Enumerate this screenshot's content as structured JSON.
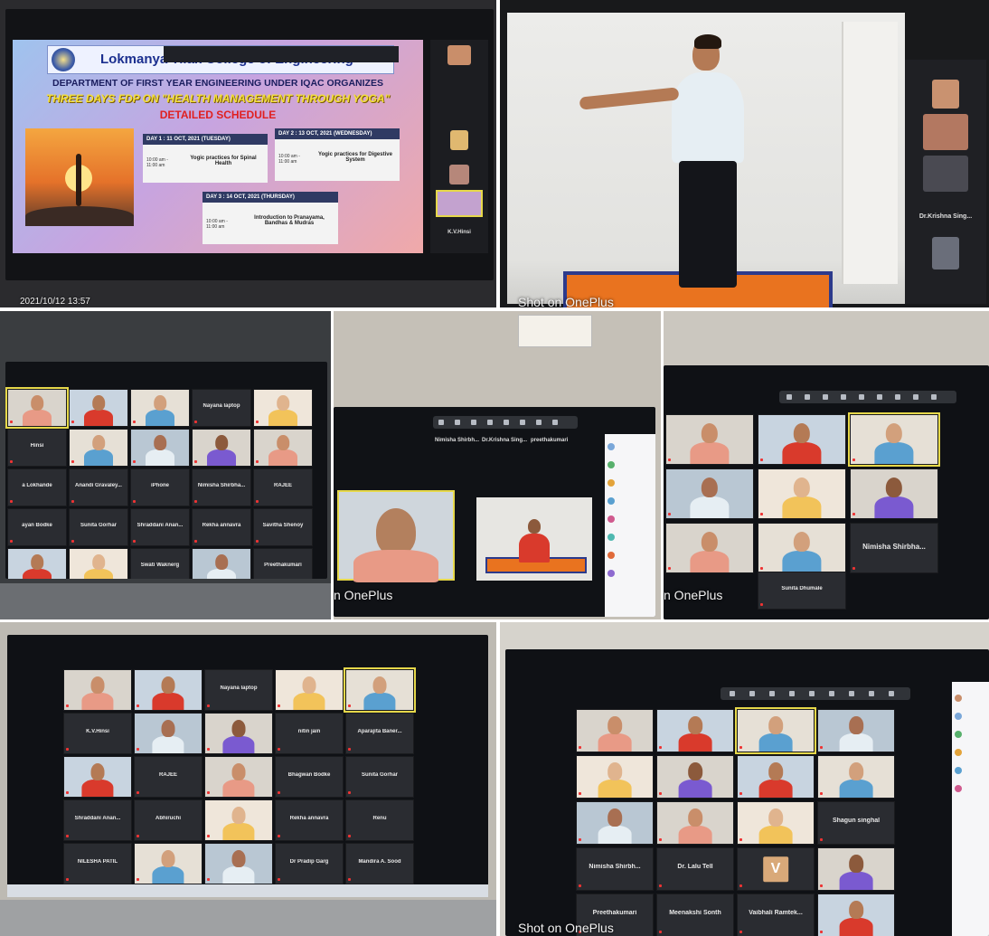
{
  "panel1": {
    "college": "Lokmanya Tilak College of Engineering",
    "department": "DEPARTMENT OF FIRST YEAR ENGINEERING UNDER IQAC ORGANIZES",
    "fdp_title": "THREE DAYS FDP ON \"HEALTH MANAGEMENT THROUGH YOGA\"",
    "schedule": "DETAILED SCHEDULE",
    "day1": "DAY 1 : 11 OCT, 2021 (TUESDAY)",
    "day1_topic": "Yogic practices for Spinal Health",
    "day2": "DAY 2 : 13 OCT, 2021 (WEDNESDAY)",
    "day2_topic": "Yogic practices for Digestive System",
    "day3": "DAY 3 : 14 OCT, 2021 (THURSDAY)",
    "day3_topic": "Introduction to Pranayama, Bandhas & Mudras",
    "col_time": "TIME",
    "col_topic": "TOPIC",
    "time_val": "10:00 am - 11:00 am",
    "timestamp": "2021/10/12 13:57",
    "side_name": "K.V.Hinsi"
  },
  "panel2": {
    "watermark": "Shot on OnePlus",
    "side_name": "Dr.Krishna Sing..."
  },
  "panel3": {
    "names": [
      "Nayana laptop",
      "Hinsi",
      "a Lokhande",
      "Anandi Gravaley...",
      "iPhone",
      "Nimisha Shirbha...",
      "RAJEE",
      "ayan Bodke",
      "Sunita Gorhar",
      "Shraddani Anan...",
      "Rekha annavra",
      "Savitha Shenoy",
      "Swati Waknerg",
      "Preethakumari"
    ]
  },
  "panel4": {
    "watermark": "n OnePlus",
    "top_names": [
      "Nimisha Shirbh...",
      "Dr.Krishna Sing...",
      "preethakumari"
    ]
  },
  "panel5": {
    "watermark": "n OnePlus",
    "names": [
      "Nimisha Shirbha...",
      "Sunita Dhumale"
    ]
  },
  "panel6": {
    "names": [
      "Nayana laptop",
      "K.V.Hinsi",
      "nitin jain",
      "Aparajita Baner...",
      "RAJEE",
      "Bhagwan Bodke",
      "Sunita Gorhar",
      "Shraddani Anan...",
      "Abhiruchi",
      "Rekha annavra",
      "Renu",
      "NILESHA PATIL",
      "Dr Pradip Garg",
      "Mandira A. Sood"
    ]
  },
  "panel7": {
    "watermark": "Shot on OnePlus",
    "names": [
      "Shagun singhal",
      "Nimisha Shirbh...",
      "Dr. Lalu Tell",
      "Preethakumari",
      "Meenakshi Sonth",
      "Vaibhali Ramtek..."
    ],
    "avatar_letter": "V"
  },
  "colors": {
    "zoom_tile": "#2a2c31",
    "zoom_bg": "#0f1115",
    "highlight": "#e6d84a",
    "title_yellow": "#f4e03a",
    "title_red": "#e02020"
  }
}
